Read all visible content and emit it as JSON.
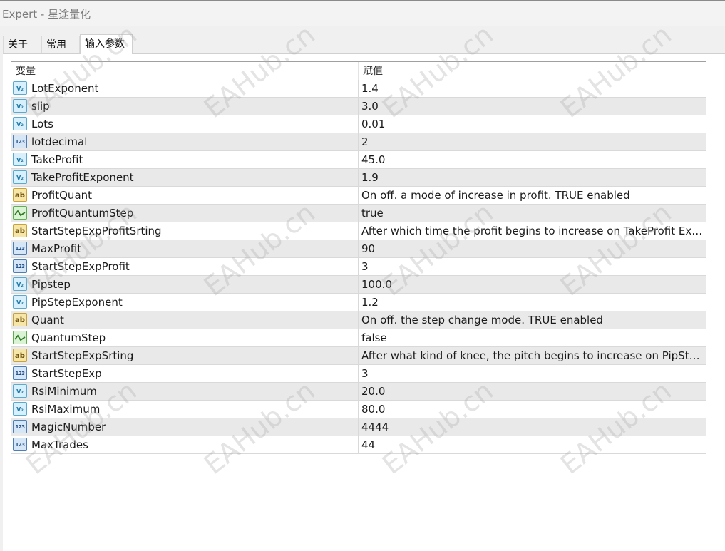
{
  "window": {
    "title": "Expert - 星途量化"
  },
  "tabs": [
    {
      "label": "关于"
    },
    {
      "label": "常用"
    },
    {
      "label": "输入参数"
    }
  ],
  "table": {
    "headers": {
      "name": "变量",
      "value": "赋值"
    },
    "rows": [
      {
        "name": "LotExponent",
        "value": "1.4",
        "type": "double"
      },
      {
        "name": "slip",
        "value": "3.0",
        "type": "double"
      },
      {
        "name": "Lots",
        "value": "0.01",
        "type": "double"
      },
      {
        "name": "lotdecimal",
        "value": "2",
        "type": "int"
      },
      {
        "name": "TakeProfit",
        "value": "45.0",
        "type": "double"
      },
      {
        "name": "TakeProfitExponent",
        "value": "1.9",
        "type": "double"
      },
      {
        "name": "ProfitQuant",
        "value": "On off. a mode of increase in profit. TRUE enabled",
        "type": "string"
      },
      {
        "name": "ProfitQuantumStep",
        "value": "true",
        "type": "bool"
      },
      {
        "name": "StartStepExpProfitSrting",
        "value": "After which time the profit begins to increase on TakeProfit Exp...",
        "type": "string"
      },
      {
        "name": "MaxProfit",
        "value": "90",
        "type": "int"
      },
      {
        "name": "StartStepExpProfit",
        "value": "3",
        "type": "int"
      },
      {
        "name": "Pipstep",
        "value": "100.0",
        "type": "double"
      },
      {
        "name": "PipStepExponent",
        "value": "1.2",
        "type": "double"
      },
      {
        "name": "Quant",
        "value": "On off. the step change mode. TRUE enabled",
        "type": "string"
      },
      {
        "name": "QuantumStep",
        "value": "false",
        "type": "bool"
      },
      {
        "name": "StartStepExpSrting",
        "value": "After what kind of knee, the pitch begins to increase on PipStep...",
        "type": "string"
      },
      {
        "name": "StartStepExp",
        "value": "3",
        "type": "int"
      },
      {
        "name": "RsiMinimum",
        "value": "20.0",
        "type": "double"
      },
      {
        "name": "RsiMaximum",
        "value": "80.0",
        "type": "double"
      },
      {
        "name": "MagicNumber",
        "value": "4444",
        "type": "int"
      },
      {
        "name": "MaxTrades",
        "value": "44",
        "type": "int"
      }
    ]
  },
  "icons": {
    "double": {
      "name": "double-type-icon",
      "glyph": "½"
    },
    "int": {
      "name": "integer-type-icon",
      "glyph": "123"
    },
    "string": {
      "name": "string-type-icon",
      "glyph": "ab"
    },
    "bool": {
      "name": "bool-type-icon",
      "glyph": ""
    }
  },
  "watermark": "EAHub.cn",
  "colors": {
    "alt_row": "#e9e9e9",
    "grid_line": "#d9d9d9",
    "title_text": "#7a7a7a"
  }
}
